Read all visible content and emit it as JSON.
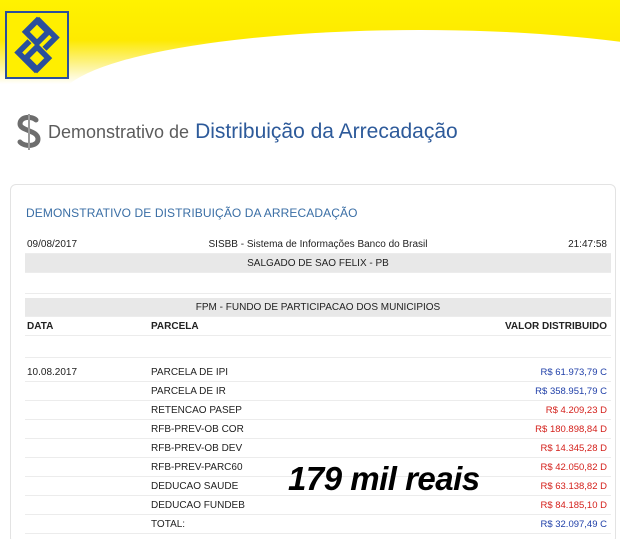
{
  "header": {
    "logo": "banco-do-brasil-logo",
    "brand_color": "#fff200",
    "logo_blue": "#2a4f9c"
  },
  "page": {
    "title_prefix": "Demonstrativo de",
    "title_main": "Distribuição da Arrecadação",
    "title_icon": "dollar-s-icon"
  },
  "card": {
    "title": "DEMONSTRATIVO DE DISTRIBUIÇÃO DA ARRECADAÇÃO",
    "info": {
      "date": "09/08/2017",
      "system": "SISBB - Sistema de Informações Banco do Brasil",
      "time": "21:47:58"
    },
    "municipality": "SALGADO DE SAO FELIX - PB",
    "fund": "FPM - FUNDO DE PARTICIPACAO DOS MUNICIPIOS",
    "columns": {
      "data": "DATA",
      "parcela": "PARCELA",
      "valor": "VALOR DISTRIBUIDO"
    },
    "entry_date": "10.08.2017",
    "rows": [
      {
        "parcela": "PARCELA DE IPI",
        "valor": "R$ 61.973,79 C",
        "type": "C"
      },
      {
        "parcela": "PARCELA DE IR",
        "valor": "R$ 358.951,79 C",
        "type": "C"
      },
      {
        "parcela": "RETENCAO PASEP",
        "valor": "R$ 4.209,23 D",
        "type": "D"
      },
      {
        "parcela": "RFB-PREV-OB COR",
        "valor": "R$ 180.898,84 D",
        "type": "D"
      },
      {
        "parcela": "RFB-PREV-OB DEV",
        "valor": "R$ 14.345,28 D",
        "type": "D"
      },
      {
        "parcela": "RFB-PREV-PARC60",
        "valor": "R$ 42.050,82 D",
        "type": "D"
      },
      {
        "parcela": "DEDUCAO SAUDE",
        "valor": "R$ 63.138,82 D",
        "type": "D"
      },
      {
        "parcela": "DEDUCAO FUNDEB",
        "valor": "R$ 84.185,10 D",
        "type": "D"
      },
      {
        "parcela": "TOTAL:",
        "valor": "R$ 32.097,49 C",
        "type": "C"
      }
    ],
    "colors": {
      "credit": "#1f3fa8",
      "debit": "#d4201b"
    }
  },
  "overlay": {
    "text": "179 mil reais"
  }
}
